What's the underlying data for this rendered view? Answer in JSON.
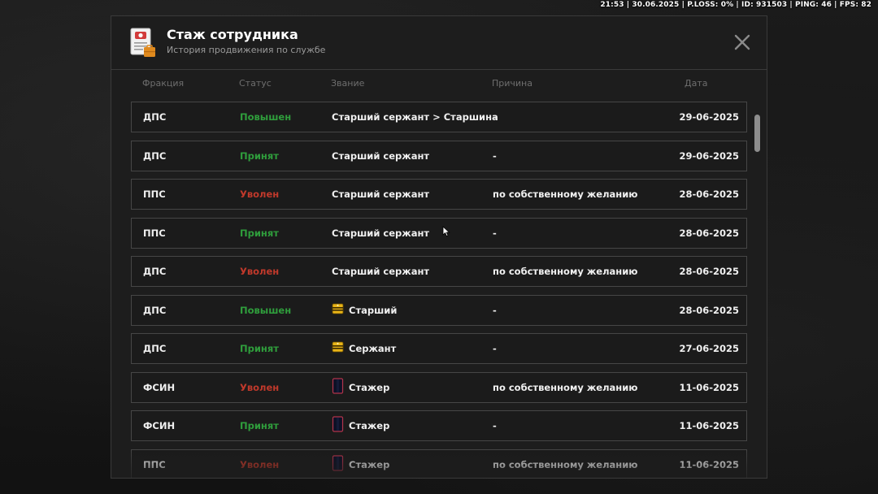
{
  "hud": {
    "stats_text": "21:53 | 30.06.2025 | P.LOSS: 0% | ID: 931503 | PING: 46 | FPS: 82"
  },
  "modal": {
    "title": "Стаж сотрудника",
    "subtitle": "История продвижения по службе",
    "icon": "document-icon",
    "close_icon": "close-icon"
  },
  "columns": {
    "faction": "Фракция",
    "status": "Статус",
    "rank": "Звание",
    "reason": "Причина",
    "date": "Дата"
  },
  "colors": {
    "promoted": "#2f9e3c",
    "hired": "#2f9e3c",
    "fired": "#c0392b",
    "row_border": "#464646",
    "panel_bg": "#1d1d1d"
  },
  "rows": [
    {
      "faction": "ДПС",
      "status": "Повышен",
      "status_type": "promoted",
      "rank_icon": "",
      "rank": "Старший сержант > Старшина",
      "reason": "-",
      "date": "29-06-2025"
    },
    {
      "faction": "ДПС",
      "status": "Принят",
      "status_type": "hired",
      "rank_icon": "",
      "rank": "Старший сержант",
      "reason": "-",
      "date": "29-06-2025"
    },
    {
      "faction": "ППС",
      "status": "Уволен",
      "status_type": "fired",
      "rank_icon": "",
      "rank": "Старший сержант",
      "reason": "по собственному желанию",
      "date": "28-06-2025"
    },
    {
      "faction": "ППС",
      "status": "Принят",
      "status_type": "hired",
      "rank_icon": "",
      "rank": "Старший сержант",
      "reason": "-",
      "date": "28-06-2025"
    },
    {
      "faction": "ДПС",
      "status": "Уволен",
      "status_type": "fired",
      "rank_icon": "",
      "rank": "Старший сержант",
      "reason": "по собственному желанию",
      "date": "28-06-2025"
    },
    {
      "faction": "ДПС",
      "status": "Повышен",
      "status_type": "promoted",
      "rank_icon": "shoulder-strap-gold-icon",
      "rank": "Старший",
      "reason": "-",
      "date": "28-06-2025"
    },
    {
      "faction": "ДПС",
      "status": "Принят",
      "status_type": "hired",
      "rank_icon": "shoulder-strap-gold-icon",
      "rank": "Сержант",
      "reason": "-",
      "date": "27-06-2025"
    },
    {
      "faction": "ФСИН",
      "status": "Уволен",
      "status_type": "fired",
      "rank_icon": "shoulder-strap-dark-icon",
      "rank": "Стажер",
      "reason": "по собственному желанию",
      "date": "11-06-2025"
    },
    {
      "faction": "ФСИН",
      "status": "Принят",
      "status_type": "hired",
      "rank_icon": "shoulder-strap-dark-icon",
      "rank": "Стажер",
      "reason": "-",
      "date": "11-06-2025"
    },
    {
      "faction": "ППС",
      "status": "Уволен",
      "status_type": "fired",
      "rank_icon": "shoulder-strap-dark-icon",
      "rank": "Стажер",
      "reason": "по собственному желанию",
      "date": "11-06-2025"
    }
  ]
}
